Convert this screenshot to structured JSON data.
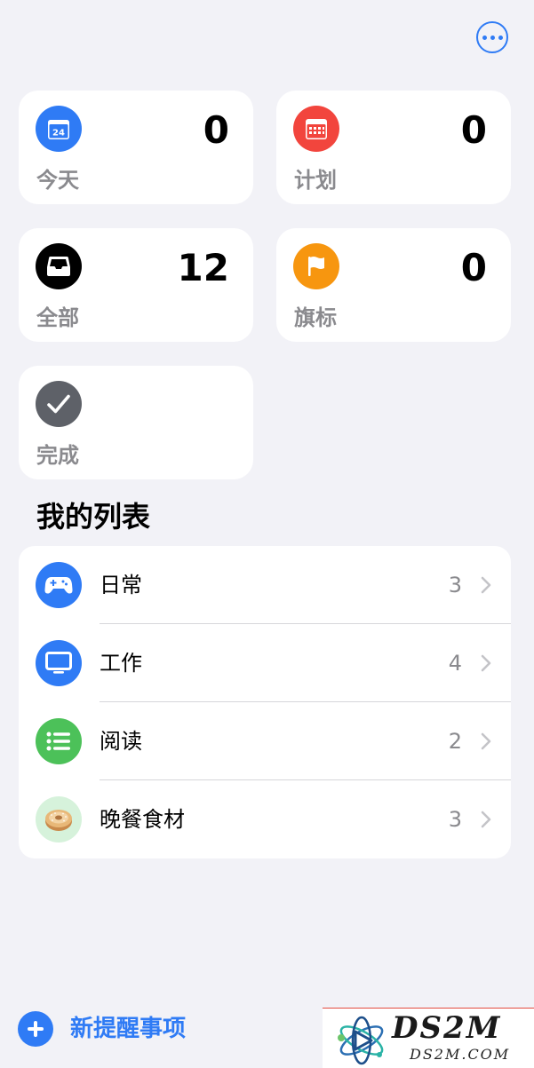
{
  "header": {
    "more_icon": "ellipsis-circle-icon"
  },
  "smart_lists": [
    {
      "id": "today",
      "label": "今天",
      "count": "0",
      "icon": "calendar-today-icon",
      "icon_text": "24",
      "color": "#2F7BF5"
    },
    {
      "id": "scheduled",
      "label": "计划",
      "count": "0",
      "icon": "calendar-grid-icon",
      "color": "#F2453D"
    },
    {
      "id": "all",
      "label": "全部",
      "count": "12",
      "icon": "tray-icon",
      "color": "#000000"
    },
    {
      "id": "flagged",
      "label": "旗标",
      "count": "0",
      "icon": "flag-icon",
      "color": "#F7960F"
    },
    {
      "id": "completed",
      "label": "完成",
      "icon": "checkmark-icon",
      "color": "#5E6168"
    }
  ],
  "my_lists": {
    "title": "我的列表",
    "items": [
      {
        "name": "日常",
        "count": "3",
        "icon": "gamecontroller-icon",
        "color": "#2F7BF5"
      },
      {
        "name": "工作",
        "count": "4",
        "icon": "display-icon",
        "color": "#2F7BF5"
      },
      {
        "name": "阅读",
        "count": "2",
        "icon": "list-bullet-icon",
        "color": "#4CC159"
      },
      {
        "name": "晚餐食材",
        "count": "3",
        "icon": "bagel-emoji-icon",
        "color": "#D6F2DB"
      }
    ]
  },
  "footer": {
    "new_reminder_label": "新提醒事项",
    "plus_icon": "plus-circle-icon"
  },
  "watermark": {
    "title": "DS2M",
    "subtitle": "DS2M.COM"
  }
}
